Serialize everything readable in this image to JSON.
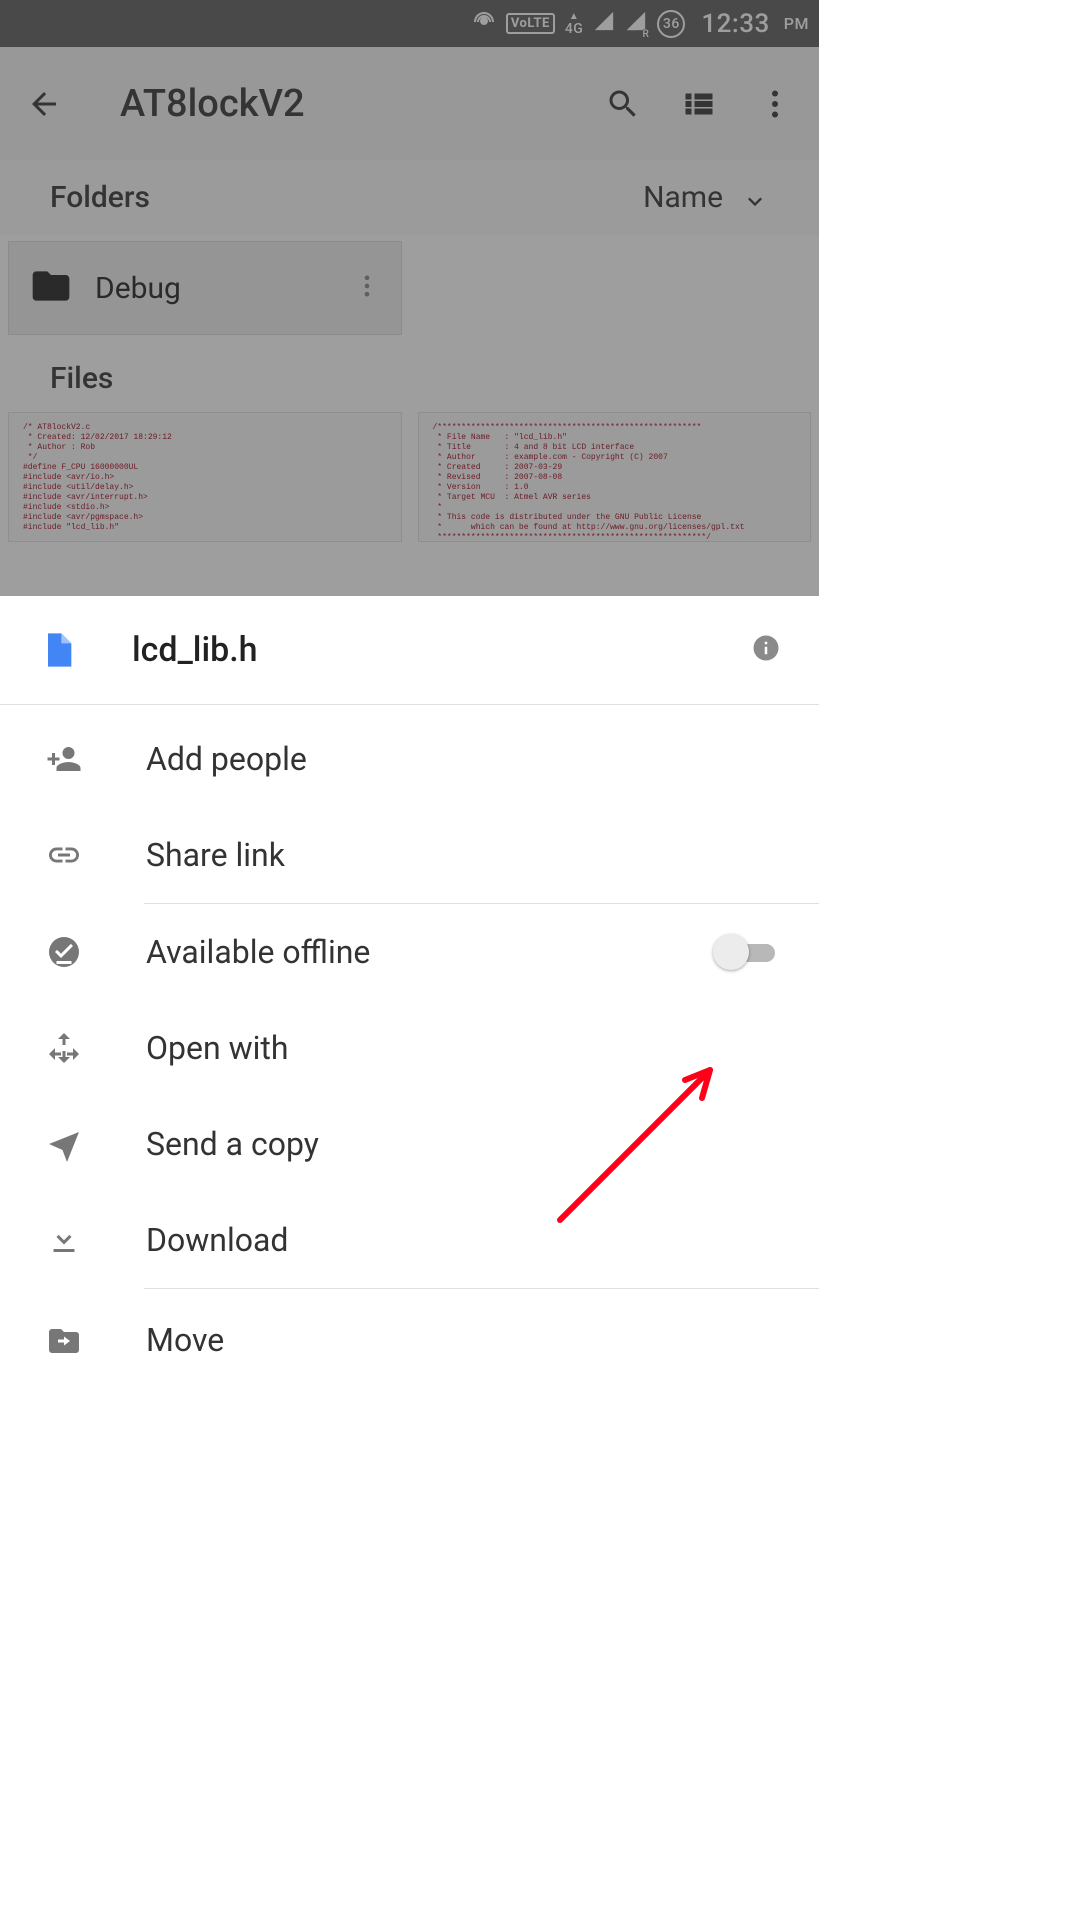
{
  "statusbar": {
    "net_label": "4G",
    "volte": "VoLTE",
    "battery": "36",
    "time": "12:33",
    "ampm": "PM"
  },
  "appbar": {
    "title": "AT8lockV2"
  },
  "listing": {
    "folders_header": "Folders",
    "sort_label": "Name",
    "folder_name": "Debug",
    "files_header": "Files"
  },
  "sheet": {
    "file_name": "lcd_lib.h",
    "add_people": "Add people",
    "share_link": "Share link",
    "available_offline": "Available offline",
    "open_with": "Open with",
    "send_copy": "Send a copy",
    "download": "Download",
    "move": "Move"
  }
}
